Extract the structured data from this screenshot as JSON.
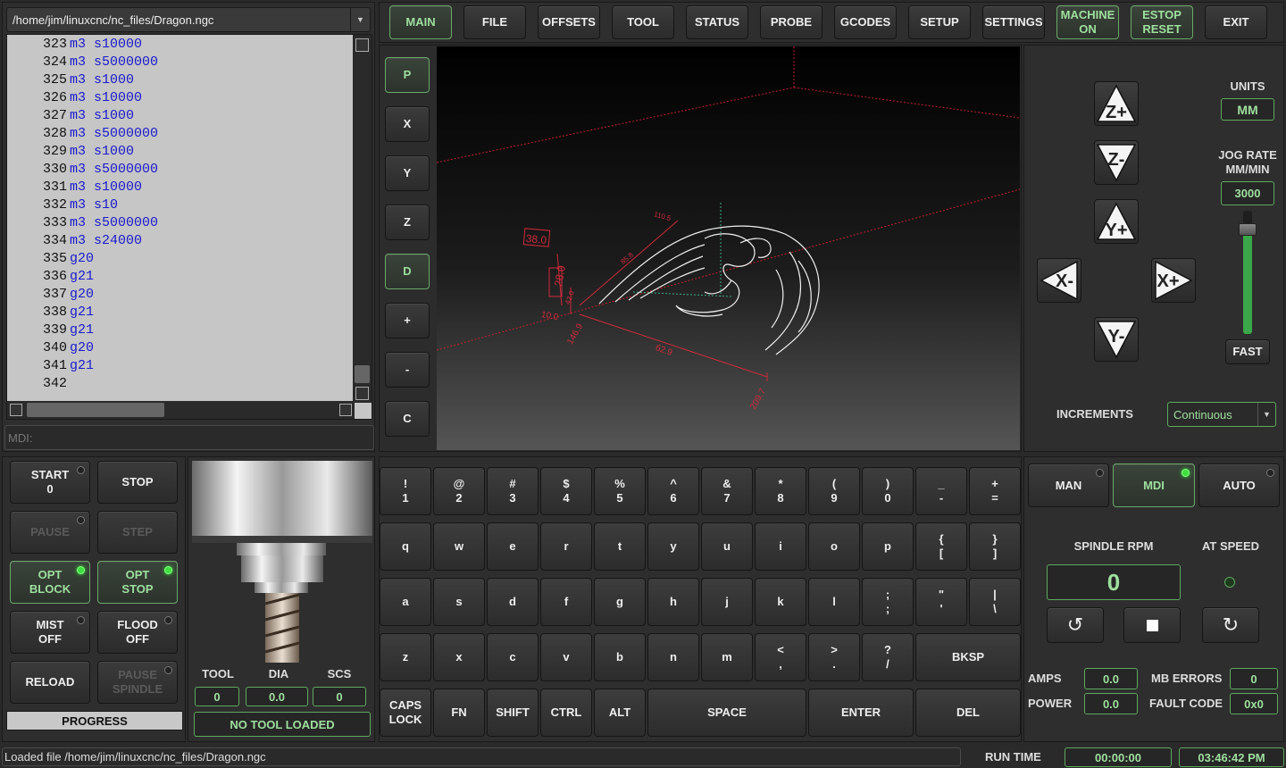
{
  "file": {
    "path": "/home/jim/linuxcnc/nc_files/Dragon.ngc"
  },
  "gcode_lines": [
    {
      "n": "323",
      "a": "m3",
      "b": "s10000"
    },
    {
      "n": "324",
      "a": "m3",
      "b": "s5000000"
    },
    {
      "n": "325",
      "a": "m3",
      "b": "s1000"
    },
    {
      "n": "326",
      "a": "m3",
      "b": "s10000"
    },
    {
      "n": "327",
      "a": "m3",
      "b": "s1000"
    },
    {
      "n": "328",
      "a": "m3",
      "b": "s5000000"
    },
    {
      "n": "329",
      "a": "m3",
      "b": "s1000"
    },
    {
      "n": "330",
      "a": "m3",
      "b": "s5000000"
    },
    {
      "n": "331",
      "a": "m3",
      "b": "s10000"
    },
    {
      "n": "332",
      "a": "m3",
      "b": "s10"
    },
    {
      "n": "333",
      "a": "m3",
      "b": "s5000000"
    },
    {
      "n": "334",
      "a": "m3",
      "b": "s24000"
    },
    {
      "n": "335",
      "a": "g20",
      "b": ""
    },
    {
      "n": "336",
      "a": "g21",
      "b": ""
    },
    {
      "n": "337",
      "a": "g20",
      "b": ""
    },
    {
      "n": "338",
      "a": "g21",
      "b": ""
    },
    {
      "n": "339",
      "a": "g21",
      "b": ""
    },
    {
      "n": "340",
      "a": "g20",
      "b": ""
    },
    {
      "n": "341",
      "a": "g21",
      "b": ""
    },
    {
      "n": "342",
      "a": "",
      "b": ""
    }
  ],
  "mdi": {
    "placeholder": "MDI:"
  },
  "tabs": [
    "MAIN",
    "FILE",
    "OFFSETS",
    "TOOL",
    "STATUS",
    "PROBE",
    "GCODES",
    "SETUP",
    "SETTINGS"
  ],
  "top_buttons": {
    "machine_on": "MACHINE\nON",
    "estop": "ESTOP\nRESET",
    "exit": "EXIT"
  },
  "view_buttons": [
    "P",
    "X",
    "Y",
    "Z",
    "D",
    "+",
    "-",
    "C"
  ],
  "preview": {
    "dim_labels": [
      "38.0",
      "28.0",
      "10.0",
      "146.9",
      "62.9",
      "209.7",
      "110.5",
      "85.8",
      "42.0"
    ]
  },
  "jog": {
    "units_label": "UNITS",
    "units_value": "MM",
    "jog_rate_label": "JOG RATE\nMM/MIN",
    "jog_rate_value": "3000",
    "fast_label": "FAST",
    "increments_label": "INCREMENTS",
    "increments_value": "Continuous",
    "buttons": {
      "zp": "Z+",
      "zm": "Z-",
      "yp": "Y+",
      "ym": "Y-",
      "xp": "X+",
      "xm": "X-"
    },
    "slider_level": 0.85
  },
  "controls": {
    "start": "START\n0",
    "stop": "STOP",
    "pause": "PAUSE",
    "step": "STEP",
    "opt_block": "OPT\nBLOCK",
    "opt_stop": "OPT\nSTOP",
    "mist": "MIST\nOFF",
    "flood": "FLOOD\nOFF",
    "reload": "RELOAD",
    "pause_spindle": "PAUSE\nSPINDLE",
    "progress": "PROGRESS"
  },
  "tool": {
    "tool_label": "TOOL",
    "dia_label": "DIA",
    "scs_label": "SCS",
    "tool_value": "0",
    "dia_value": "0.0",
    "scs_value": "0",
    "status": "NO TOOL LOADED"
  },
  "keyboard": {
    "row1": [
      "!\n1",
      "@\n2",
      "#\n3",
      "$\n4",
      "%\n5",
      "^\n6",
      "&\n7",
      "*\n8",
      "(\n9",
      ")\n0",
      "_\n-",
      "+\n="
    ],
    "row2": [
      "q",
      "w",
      "e",
      "r",
      "t",
      "y",
      "u",
      "i",
      "o",
      "p",
      "{\n[",
      "}\n]"
    ],
    "row3": [
      "a",
      "s",
      "d",
      "f",
      "g",
      "h",
      "j",
      "k",
      "l",
      ";\n;",
      "\"\n'",
      "|\n\\"
    ],
    "row4": [
      "z",
      "x",
      "c",
      "v",
      "b",
      "n",
      "m",
      "<\n,",
      ">\n.",
      "?\n/"
    ],
    "bksp": "BKSP",
    "row5": [
      "CAPS\nLOCK",
      "FN",
      "SHIFT",
      "CTRL",
      "ALT"
    ],
    "space": "SPACE",
    "enter": "ENTER",
    "del": "DEL"
  },
  "modes": {
    "man": "MAN",
    "mdi": "MDI",
    "auto": "AUTO"
  },
  "spindle": {
    "rpm_label": "SPINDLE RPM",
    "rpm_value": "0",
    "at_speed_label": "AT SPEED"
  },
  "stats": {
    "amps_label": "AMPS",
    "amps_value": "0.0",
    "power_label": "POWER",
    "power_value": "0.0",
    "mb_errors_label": "MB ERRORS",
    "mb_errors_value": "0",
    "fault_code_label": "FAULT CODE",
    "fault_code_value": "0x0"
  },
  "statusbar": {
    "message": "Loaded file /home/jim/linuxcnc/nc_files/Dragon.ngc",
    "run_time_label": "RUN TIME",
    "run_time_value": "00:00:00",
    "clock": "03:46:42 PM"
  },
  "colors": {
    "accent_green": "#9fdf9f",
    "led_green": "#3ee03e",
    "gcode_keyword": "#1a1acc",
    "preview_red": "#cc2b3b"
  }
}
